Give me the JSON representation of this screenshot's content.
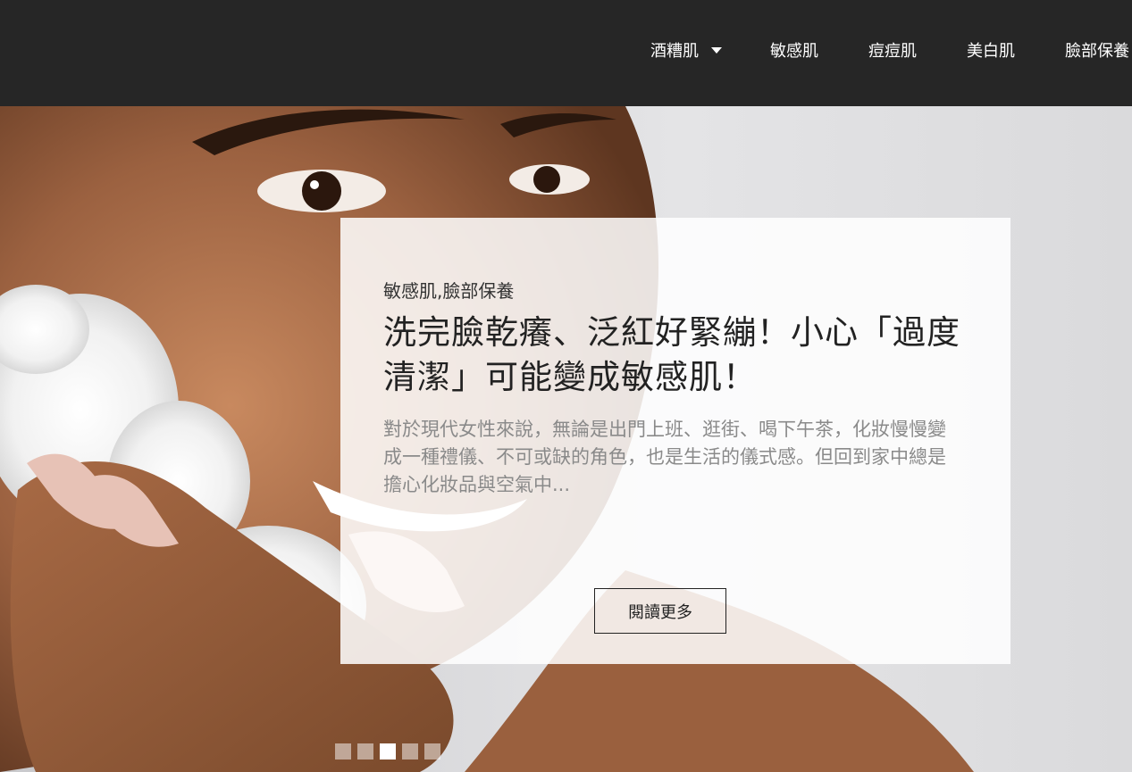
{
  "nav": {
    "items": [
      {
        "label": "酒糟肌",
        "has_dropdown": true
      },
      {
        "label": "敏感肌"
      },
      {
        "label": "痘痘肌"
      },
      {
        "label": "美白肌"
      },
      {
        "label": "臉部保養"
      }
    ]
  },
  "slide": {
    "category": "敏感肌,臉部保養",
    "title": "洗完臉乾癢、泛紅好緊繃！小心「過度清潔」可能變成敏感肌！",
    "excerpt": "對於現代女性來說，無論是出門上班、逛街、喝下午茶，化妝慢慢變成一種禮儀、不可或缺的角色，也是生活的儀式感。但回到家中總是擔心化妝品與空氣中...",
    "read_more_label": "閱讀更多"
  },
  "carousel": {
    "total_slides": 5,
    "active_index": 2
  },
  "colors": {
    "nav_background": "#262626",
    "nav_text": "#ffffff",
    "card_background": "#ffffff",
    "title_text": "#222222",
    "excerpt_text": "#8a8a8a"
  }
}
